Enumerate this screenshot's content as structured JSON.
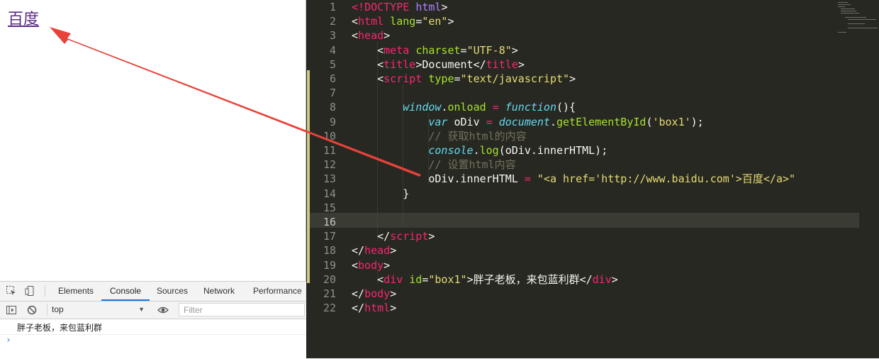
{
  "browser": {
    "link_text": "百度"
  },
  "devtools": {
    "tabs": [
      "Elements",
      "Console",
      "Sources",
      "Network",
      "Performance"
    ],
    "active_tab": "Console",
    "context": "top",
    "filter_placeholder": "Filter",
    "console_output": "胖子老板，来包蓝利群",
    "prompt": "›"
  },
  "editor": {
    "current_line": 16,
    "lines": [
      {
        "n": "1",
        "t": [
          [
            "<!",
            "tk-tag"
          ],
          [
            "DOCTYPE",
            "tk-tag"
          ],
          [
            " ",
            ""
          ],
          [
            "html",
            "tk-doc"
          ],
          [
            ">",
            ""
          ]
        ]
      },
      {
        "n": "2",
        "t": [
          [
            "<",
            ""
          ],
          [
            "html",
            "tk-tag"
          ],
          [
            " ",
            ""
          ],
          [
            "lang",
            "tk-attr"
          ],
          [
            "=",
            ""
          ],
          [
            "\"en\"",
            "tk-str"
          ],
          [
            ">",
            ""
          ]
        ]
      },
      {
        "n": "3",
        "t": [
          [
            "<",
            ""
          ],
          [
            "head",
            "tk-tag"
          ],
          [
            ">",
            ""
          ]
        ]
      },
      {
        "n": "4",
        "t": [
          [
            "    <",
            ""
          ],
          [
            "meta",
            "tk-tag"
          ],
          [
            " ",
            ""
          ],
          [
            "charset",
            "tk-attr"
          ],
          [
            "=",
            ""
          ],
          [
            "\"UTF-8\"",
            "tk-str"
          ],
          [
            ">",
            ""
          ]
        ]
      },
      {
        "n": "5",
        "t": [
          [
            "    <",
            ""
          ],
          [
            "title",
            "tk-tag"
          ],
          [
            ">Document</",
            ""
          ],
          [
            "title",
            "tk-tag"
          ],
          [
            ">",
            ""
          ]
        ]
      },
      {
        "n": "6",
        "t": [
          [
            "    <",
            ""
          ],
          [
            "script",
            "tk-tag"
          ],
          [
            " ",
            ""
          ],
          [
            "type",
            "tk-attr"
          ],
          [
            "=",
            ""
          ],
          [
            "\"text/javascript\"",
            "tk-str"
          ],
          [
            ">",
            ""
          ]
        ]
      },
      {
        "n": "7",
        "t": []
      },
      {
        "n": "8",
        "t": [
          [
            "        ",
            ""
          ],
          [
            "window",
            "tk-kw"
          ],
          [
            ".",
            ""
          ],
          [
            "onload",
            "tk-fn"
          ],
          [
            " ",
            ""
          ],
          [
            "=",
            "tk-op"
          ],
          [
            " ",
            ""
          ],
          [
            "function",
            "tk-kw"
          ],
          [
            "(){",
            ""
          ]
        ]
      },
      {
        "n": "9",
        "t": [
          [
            "            ",
            ""
          ],
          [
            "var",
            "tk-kw"
          ],
          [
            " oDiv ",
            ""
          ],
          [
            "=",
            "tk-op"
          ],
          [
            " ",
            ""
          ],
          [
            "document",
            "tk-kw"
          ],
          [
            ".",
            ""
          ],
          [
            "getElementById",
            "tk-fn"
          ],
          [
            "(",
            ""
          ],
          [
            "'box1'",
            "tk-str"
          ],
          [
            ");",
            ""
          ]
        ]
      },
      {
        "n": "10",
        "t": [
          [
            "            ",
            ""
          ],
          [
            "// 获取html的内容",
            "tk-cm"
          ]
        ]
      },
      {
        "n": "11",
        "t": [
          [
            "            ",
            ""
          ],
          [
            "console",
            "tk-kw"
          ],
          [
            ".",
            ""
          ],
          [
            "log",
            "tk-fn"
          ],
          [
            "(oDiv.innerHTML);",
            ""
          ]
        ]
      },
      {
        "n": "12",
        "t": [
          [
            "            ",
            ""
          ],
          [
            "// 设置html内容",
            "tk-cm"
          ]
        ]
      },
      {
        "n": "13",
        "t": [
          [
            "            oDiv.innerHTML ",
            ""
          ],
          [
            "=",
            "tk-op"
          ],
          [
            " ",
            ""
          ],
          [
            "\"<a href='http://www.baidu.com'>百度</a>\"",
            "tk-str"
          ]
        ]
      },
      {
        "n": "14",
        "t": [
          [
            "        }",
            ""
          ]
        ]
      },
      {
        "n": "15",
        "t": []
      },
      {
        "n": "16",
        "t": []
      },
      {
        "n": "17",
        "t": [
          [
            "    </",
            ""
          ],
          [
            "script",
            "tk-tag"
          ],
          [
            ">",
            ""
          ]
        ]
      },
      {
        "n": "18",
        "t": [
          [
            "</",
            ""
          ],
          [
            "head",
            "tk-tag"
          ],
          [
            ">",
            ""
          ]
        ]
      },
      {
        "n": "19",
        "t": [
          [
            "<",
            ""
          ],
          [
            "body",
            "tk-tag"
          ],
          [
            ">",
            ""
          ]
        ]
      },
      {
        "n": "20",
        "t": [
          [
            "    <",
            ""
          ],
          [
            "div",
            "tk-tag"
          ],
          [
            " ",
            ""
          ],
          [
            "id",
            "tk-attr"
          ],
          [
            "=",
            ""
          ],
          [
            "\"box1\"",
            "tk-str"
          ],
          [
            ">胖子老板，来包蓝利群</",
            ""
          ],
          [
            "div",
            "tk-tag"
          ],
          [
            ">",
            ""
          ]
        ]
      },
      {
        "n": "21",
        "t": [
          [
            "</",
            ""
          ],
          [
            "body",
            "tk-tag"
          ],
          [
            ">",
            ""
          ]
        ]
      },
      {
        "n": "22",
        "t": [
          [
            "</",
            ""
          ],
          [
            "html",
            "tk-tag"
          ],
          [
            ">",
            ""
          ]
        ]
      }
    ]
  },
  "colors": {
    "editor_bg": "#272822",
    "arrow": "#e8423a",
    "link": "#5b2b8a",
    "active_tab_underline": "#1a73e8"
  }
}
